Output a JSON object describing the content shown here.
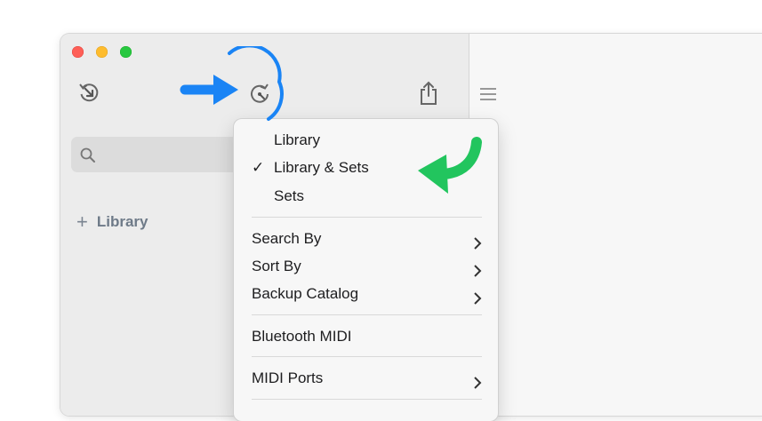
{
  "sidebar": {
    "add_library_label": "Library",
    "add_symbol": "+",
    "toolbar_icons": [
      "history-icon",
      "refresh-icon",
      "share-icon"
    ]
  },
  "menu": {
    "view_items": [
      {
        "label": "Library",
        "checked": false
      },
      {
        "label": "Library & Sets",
        "checked": true
      },
      {
        "label": "Sets",
        "checked": false
      }
    ],
    "check_mark": "✓",
    "submenu_items": [
      {
        "label": "Search By"
      },
      {
        "label": "Sort By"
      },
      {
        "label": "Backup Catalog"
      }
    ],
    "bluetooth_label": "Bluetooth MIDI",
    "midi_ports_label": "MIDI Ports"
  },
  "annotations": {
    "blue_arrow_color": "#1a84f5",
    "green_arrow_color": "#22c55e"
  }
}
